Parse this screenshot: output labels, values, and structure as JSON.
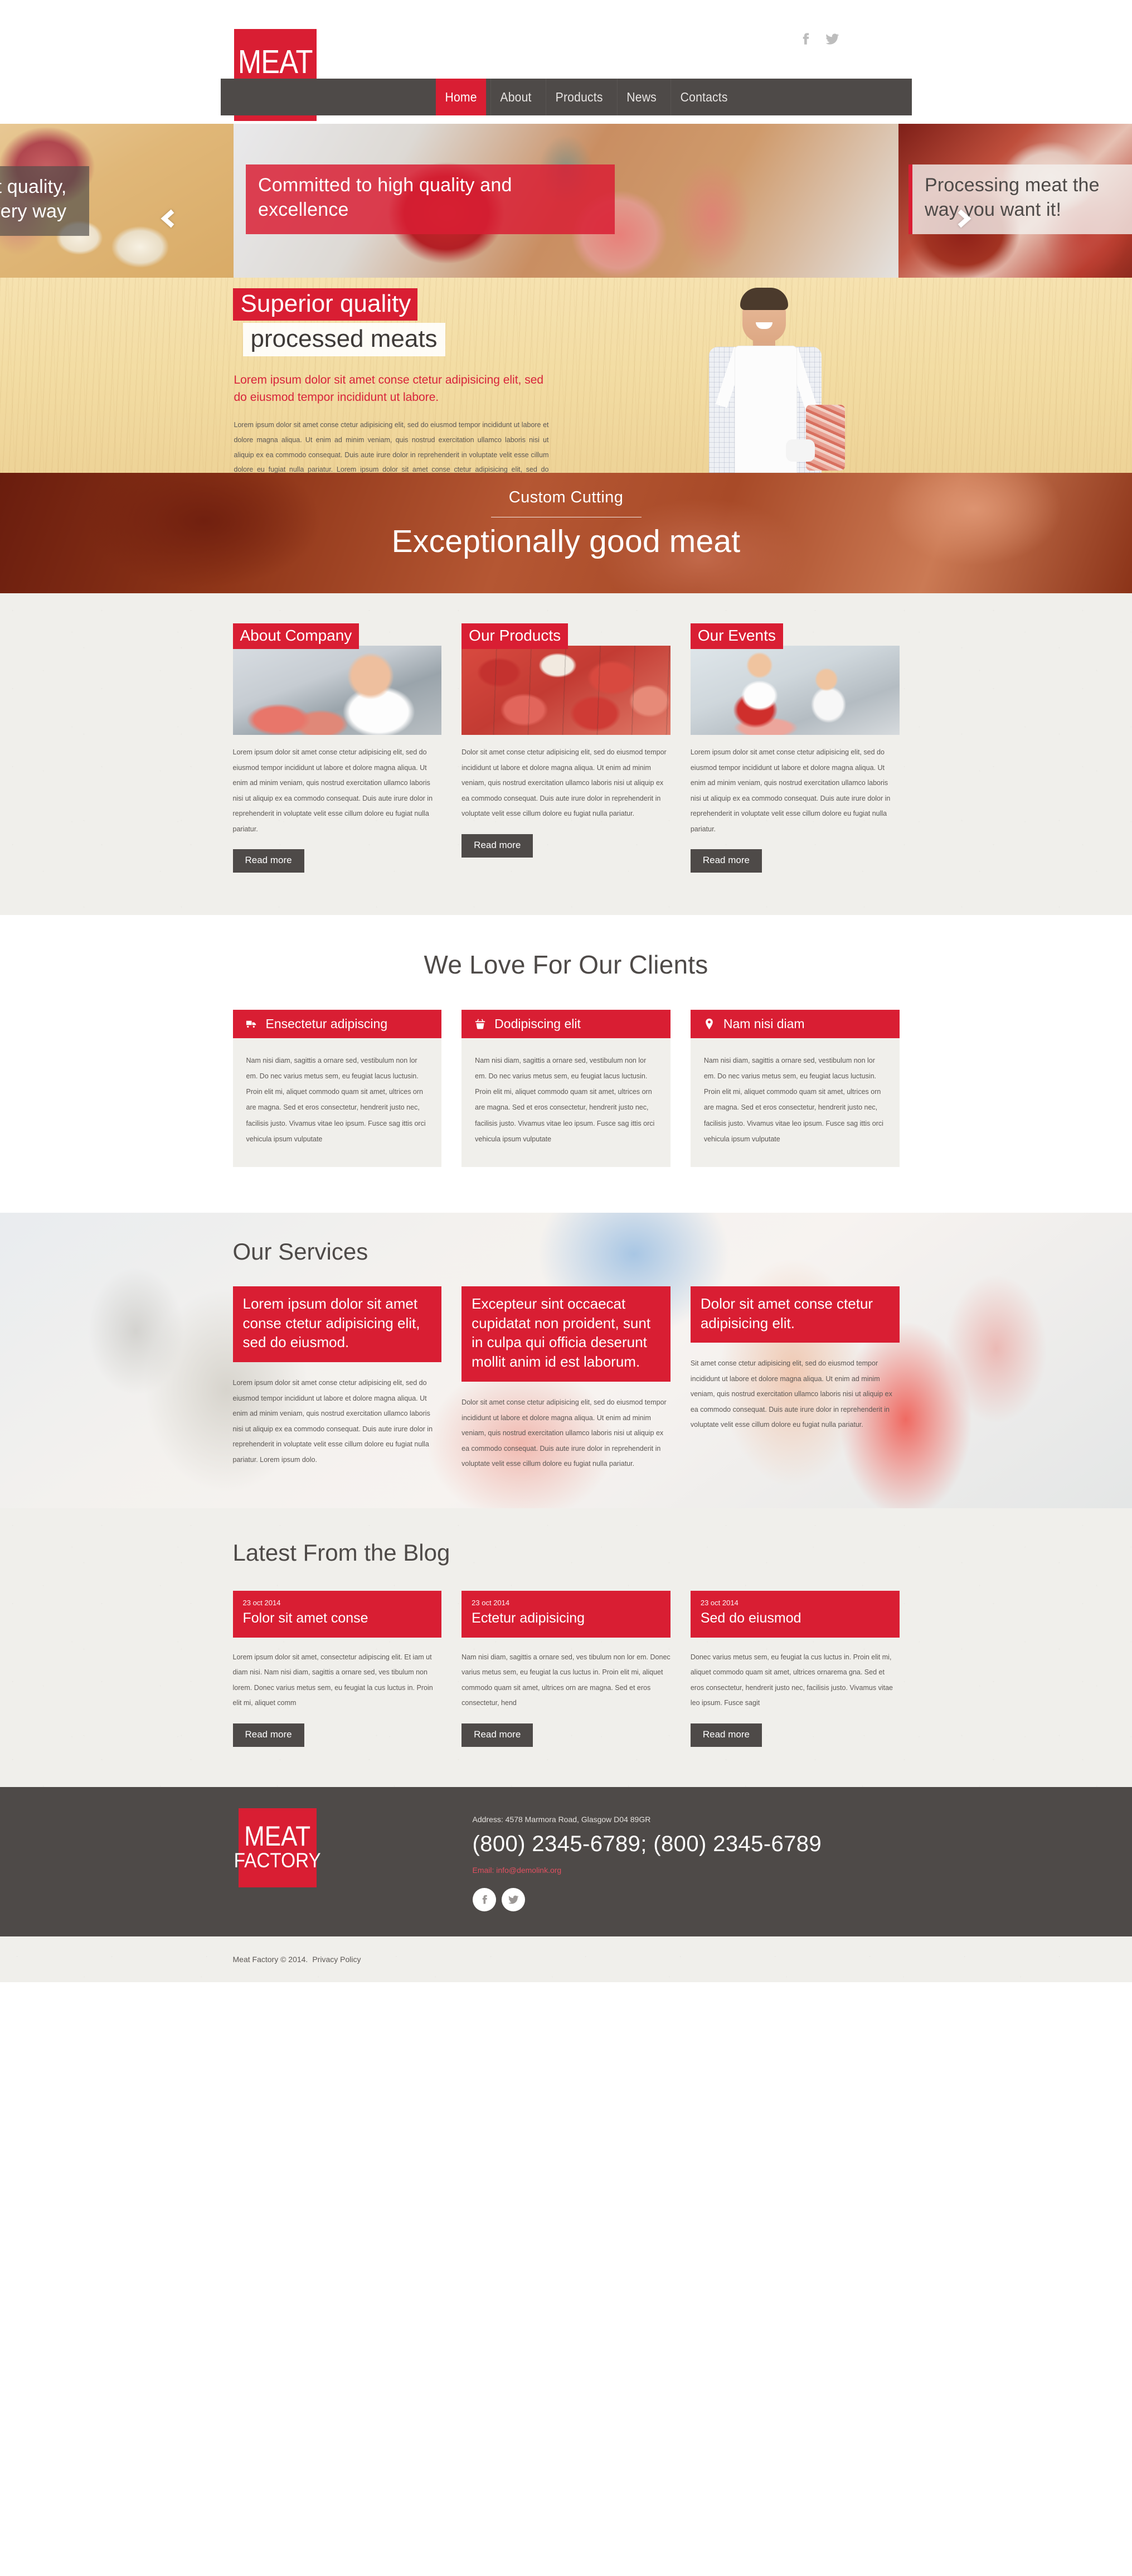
{
  "brand": {
    "logo_line1": "MEAT",
    "logo_line2": "FACTORY",
    "accent_color": "#d91e33",
    "dark_color": "#4e4a48"
  },
  "header": {
    "social": [
      {
        "name": "facebook-icon",
        "label": "Facebook"
      },
      {
        "name": "twitter-icon",
        "label": "Twitter"
      }
    ],
    "nav": [
      {
        "label": "Home",
        "active": true
      },
      {
        "label": "About",
        "active": false
      },
      {
        "label": "Products",
        "active": false
      },
      {
        "label": "News",
        "active": false
      },
      {
        "label": "Contacts",
        "active": false
      }
    ]
  },
  "slider": {
    "prev_label": "Previous slide",
    "next_label": "Next slide",
    "slides": [
      {
        "caption": "Always the best quality, every day, in every way"
      },
      {
        "caption": "Committed to high quality and excellence"
      },
      {
        "caption": "Processing meat the way you want it!"
      }
    ]
  },
  "superior": {
    "title_line1": "Superior quality",
    "title_line2": "processed meats",
    "lead": "Lorem ipsum dolor sit amet conse ctetur adipisicing elit, sed do eiusmod tempor incididunt ut labore.",
    "body": "Lorem ipsum dolor sit amet conse ctetur adipisicing elit, sed do eiusmod tempor incididunt ut labore et dolore magna aliqua. Ut enim ad minim veniam, quis nostrud exercitation ullamco laboris nisi ut aliquip ex ea commodo consequat. Duis aute irure dolor in reprehenderit in voluptate velit esse cillum dolore eu fugiat nulla pariatur. Lorem ipsum dolor sit amet conse ctetur adipisicing elit, sed do eiusmod tempor incididunt ut labore et dolore magna aliqua. Ut enim ad minim veniam, quis nostrud exercitation ullamco laboris nisi ut aliquip ex ea commodo consequat."
  },
  "cutting": {
    "subtitle": "Custom Cutting",
    "title": "Exceptionally good meat"
  },
  "features": {
    "read_more_label": "Read more",
    "items": [
      {
        "badge": "About Company",
        "photo": "butcher-holding-ribs-photo",
        "text": "Lorem ipsum dolor sit amet conse ctetur adipisicing elit, sed do eiusmod tempor incididunt ut labore et dolore magna aliqua. Ut enim ad minim veniam, quis nostrud exercitation ullamco laboris nisi ut aliquip ex ea commodo consequat. Duis aute irure dolor in reprehenderit in voluptate velit esse cillum dolore eu fugiat nulla pariatur."
      },
      {
        "badge": "Our Products",
        "photo": "meat-display-case-photo",
        "text": "Dolor sit amet conse ctetur adipisicing elit, sed do eiusmod tempor incididunt ut labore et dolore magna aliqua. Ut enim ad minim veniam, quis nostrud exercitation ullamco laboris nisi ut aliquip ex ea commodo consequat. Duis aute irure dolor in reprehenderit in voluptate velit esse cillum dolore eu fugiat nulla pariatur."
      },
      {
        "badge": "Our Events",
        "photo": "butcher-woman-with-tray-photo",
        "text": "Lorem ipsum dolor sit amet conse ctetur adipisicing elit, sed do eiusmod tempor incididunt ut labore et dolore magna aliqua. Ut enim ad minim veniam, quis nostrud exercitation ullamco laboris nisi ut aliquip ex ea commodo consequat. Duis aute irure dolor in reprehenderit in voluptate velit esse cillum dolore eu fugiat nulla pariatur."
      }
    ]
  },
  "clients": {
    "title": "We Love For Our Clients",
    "cards": [
      {
        "icon": "truck-icon",
        "title": "Ensectetur adipiscing",
        "text": "Nam nisi diam, sagittis a ornare sed, vestibulum non lor em. Do nec varius metus sem, eu feugiat lacus luctusin. Proin elit mi, aliquet commodo quam sit amet, ultrices orn are magna. Sed et eros consectetur, hendrerit justo nec, facilisis justo. Vivamus vitae leo ipsum. Fusce sag ittis orci vehicula ipsum vulputate"
      },
      {
        "icon": "basket-icon",
        "title": "Dodipiscing elit",
        "text": "Nam nisi diam, sagittis a ornare sed, vestibulum non lor em. Do nec varius metus sem, eu feugiat lacus luctusin. Proin elit mi, aliquet commodo quam sit amet, ultrices orn are magna. Sed et eros consectetur, hendrerit justo nec, facilisis justo. Vivamus vitae leo ipsum. Fusce sag ittis orci vehicula ipsum vulputate"
      },
      {
        "icon": "map-pin-icon",
        "title": "Nam nisi diam",
        "text": "Nam nisi diam, sagittis a ornare sed, vestibulum non lor em. Do nec varius metus sem, eu feugiat lacus luctusin. Proin elit mi, aliquet commodo quam sit amet, ultrices orn are magna. Sed et eros consectetur, hendrerit justo nec, facilisis justo. Vivamus vitae leo ipsum. Fusce sag ittis orci vehicula ipsum vulputate"
      }
    ]
  },
  "services": {
    "title": "Our Services",
    "items": [
      {
        "head": "Lorem ipsum dolor sit amet conse ctetur adipisicing elit, sed do eiusmod.",
        "text": "Lorem ipsum dolor sit amet conse ctetur adipisicing elit, sed do eiusmod tempor incididunt ut labore et dolore magna aliqua. Ut enim ad minim veniam, quis nostrud exercitation ullamco laboris nisi ut aliquip ex ea commodo consequat. Duis aute irure dolor in reprehenderit in voluptate velit esse cillum dolore eu fugiat nulla pariatur. Lorem ipsum dolo."
      },
      {
        "head": "Excepteur sint occaecat cupidatat non proident, sunt in culpa qui officia deserunt mollit anim id est laborum.",
        "text": "Dolor sit amet conse ctetur adipisicing elit, sed do eiusmod tempor incididunt ut labore et dolore magna aliqua. Ut enim ad minim veniam, quis nostrud exercitation ullamco laboris nisi ut aliquip ex ea commodo consequat. Duis aute irure dolor in reprehenderit in voluptate velit esse cillum dolore eu fugiat nulla pariatur."
      },
      {
        "head": "Dolor sit amet conse ctetur adipisicing elit.",
        "text": "Sit amet conse ctetur adipisicing elit, sed do eiusmod tempor incididunt ut labore et dolore magna aliqua. Ut enim ad minim veniam, quis nostrud exercitation ullamco laboris nisi ut aliquip ex ea commodo consequat. Duis aute irure dolor in reprehenderit in voluptate velit esse cillum dolore eu fugiat nulla pariatur."
      }
    ]
  },
  "blog": {
    "title": "Latest From the Blog",
    "read_more_label": "Read more",
    "posts": [
      {
        "date": "23 oct 2014",
        "title": "Folor sit amet conse",
        "text": "Lorem ipsum dolor sit amet, consectetur adipiscing elit. Et iam ut diam nisi. Nam nisi diam, sagittis a ornare sed, ves tibulum non lorem. Donec varius metus sem, eu feugiat la cus luctus in. Proin elit mi, aliquet comm"
      },
      {
        "date": "23 oct 2014",
        "title": "Ectetur adipisicing",
        "text": "Nam nisi diam, sagittis a ornare sed, ves tibulum non lor em. Donec varius metus sem, eu feugiat la cus luctus in. Proin elit mi, aliquet commodo quam sit amet, ultrices orn are magna. Sed et eros consectetur, hend"
      },
      {
        "date": "23 oct 2014",
        "title": "Sed do eiusmod",
        "text": "Donec varius metus sem, eu feugiat la cus luctus in. Proin elit mi, aliquet commodo quam sit amet, ultrices ornarema gna. Sed et eros consectetur, hendrerit justo nec, facilisis justo. Vivamus vitae leo ipsum. Fusce sagit"
      }
    ]
  },
  "footer": {
    "address": "Address: 4578 Marmora Road, Glasgow D04 89GR",
    "phone": "(800) 2345-6789; (800) 2345-6789",
    "email": "Email: info@demolink.org",
    "social": [
      {
        "name": "facebook-icon",
        "label": "Facebook"
      },
      {
        "name": "twitter-icon",
        "label": "Twitter"
      }
    ],
    "copyright": "Meat Factory © 2014.",
    "privacy_label": "Privacy Policy"
  }
}
